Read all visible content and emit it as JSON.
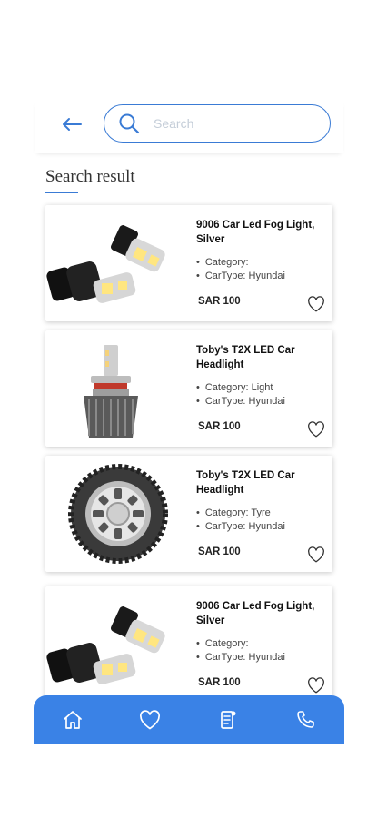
{
  "search": {
    "placeholder": "Search"
  },
  "section": {
    "title": "Search result"
  },
  "results": [
    {
      "name": "9006 Car Led Fog Light, Silver",
      "category": "Category:",
      "car_type": "CarType: Hyundai",
      "price": "SAR 100",
      "image": "fog-light"
    },
    {
      "name": "Toby's T2X LED Car Headlight",
      "category": "Category: Light",
      "car_type": "CarType: Hyundai",
      "price": "SAR 100",
      "image": "led-bulb"
    },
    {
      "name": "Toby's T2X LED Car Headlight",
      "category": "Category: Tyre",
      "car_type": "CarType: Hyundai",
      "price": "SAR 100",
      "image": "tyre"
    },
    {
      "name": "9006 Car Led Fog Light, Silver",
      "category": "Category:",
      "car_type": "CarType: Hyundai",
      "price": "SAR 100",
      "image": "fog-light"
    }
  ],
  "nav": [
    "home-icon",
    "heart-icon",
    "orders-icon",
    "phone-icon"
  ],
  "colors": {
    "accent": "#3a7bd5",
    "nav_bg": "#3a82e6"
  }
}
